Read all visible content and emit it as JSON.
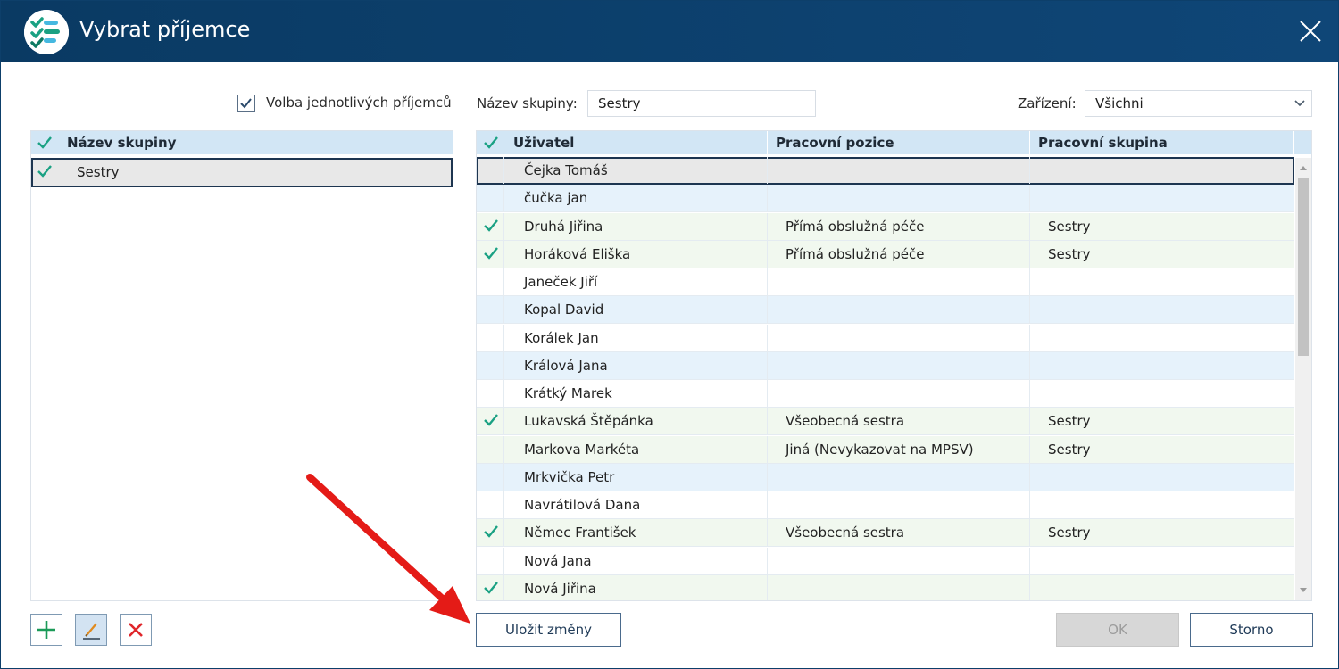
{
  "window": {
    "title": "Vybrat příjemce"
  },
  "left": {
    "individual_choice_label": "Volba jednotlivých příjemců",
    "individual_choice_checked": true,
    "groups_header": "Název skupiny",
    "groups": [
      {
        "name": "Sestry",
        "checked": true,
        "selected": true
      }
    ]
  },
  "filters": {
    "group_name_label": "Název skupiny:",
    "group_name_value": "Sestry",
    "device_label": "Zařízení:",
    "device_value": "Všichni"
  },
  "users_table": {
    "columns": [
      "Uživatel",
      "Pracovní pozice",
      "Pracovní skupina"
    ],
    "rows": [
      {
        "user": "Čejka Tomáš",
        "position": "",
        "group": "",
        "checked": false,
        "selected": true
      },
      {
        "user": "čučka jan",
        "position": "",
        "group": "",
        "checked": false
      },
      {
        "user": "Druhá Jiřina",
        "position": "Přímá obslužná péče",
        "group": "Sestry",
        "checked": true
      },
      {
        "user": "Horáková Eliška",
        "position": "Přímá obslužná péče",
        "group": "Sestry",
        "checked": true
      },
      {
        "user": "Janeček Jiří",
        "position": "",
        "group": "",
        "checked": false
      },
      {
        "user": "Kopal David",
        "position": "",
        "group": "",
        "checked": false
      },
      {
        "user": "Korálek Jan",
        "position": "",
        "group": "",
        "checked": false
      },
      {
        "user": "Králová Jana",
        "position": "",
        "group": "",
        "checked": false
      },
      {
        "user": "Krátký Marek",
        "position": "",
        "group": "",
        "checked": false
      },
      {
        "user": "Lukavská Štěpánka",
        "position": "Všeobecná sestra",
        "group": "Sestry",
        "checked": true
      },
      {
        "user": "Markova Markéta",
        "position": "Jiná (Nevykazovat na MPSV)",
        "group": "Sestry",
        "checked": false
      },
      {
        "user": "Mrkvička Petr",
        "position": "",
        "group": "",
        "checked": false
      },
      {
        "user": "Navrátilová Dana",
        "position": "",
        "group": "",
        "checked": false
      },
      {
        "user": "Němec František",
        "position": "Všeobecná sestra",
        "group": "Sestry",
        "checked": true
      },
      {
        "user": "Nová Jana",
        "position": "",
        "group": "",
        "checked": false
      },
      {
        "user": "Nová Jiřina",
        "position": "",
        "group": "",
        "checked": true
      }
    ]
  },
  "buttons": {
    "save_changes": "Uložit změny",
    "ok": "OK",
    "cancel": "Storno"
  },
  "colors": {
    "titlebar": "#0c3f6b",
    "accent_check": "#1aa183",
    "header_bg": "#d2e6f5",
    "annotation_arrow": "#e41b17",
    "delete_red": "#e0262b",
    "add_green": "#1b9a58"
  }
}
